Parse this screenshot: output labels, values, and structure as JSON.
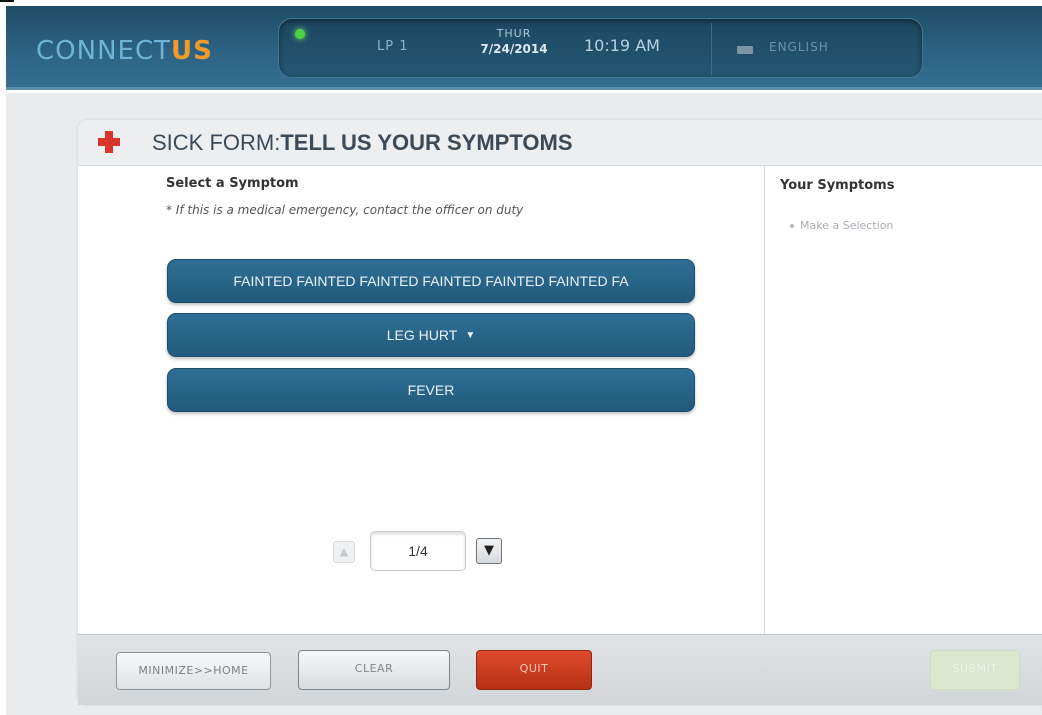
{
  "app": {
    "logo_main": "CONNECT",
    "logo_accent": "US"
  },
  "status": {
    "unit": "LP 1",
    "day": "THUR",
    "date": "7/24/2014",
    "time": "10:19 AM",
    "language": "ENGLISH"
  },
  "form": {
    "title_prefix": "SICK FORM:",
    "title_main": "TELL US YOUR SYMPTOMS",
    "select_heading": "Select a Symptom",
    "note": "* If this is a medical emergency, contact the officer on duty",
    "symptoms": [
      {
        "label": "FAINTED FAINTED FAINTED FAINTED FAINTED FAINTED FA"
      },
      {
        "label": "LEG HURT",
        "has_dropdown": true
      },
      {
        "label": "FEVER"
      }
    ],
    "pager": {
      "value": "1/4",
      "up_icon": "▲",
      "down_icon": "▼"
    }
  },
  "your_symptoms": {
    "heading": "Your Symptoms",
    "placeholder": "Make a Selection"
  },
  "footer": {
    "minimize_label": "MINIMIZE>>HOME",
    "clear_label": "CLEAR",
    "quit_label": "QUIT",
    "submit_label": "SUBMIT"
  },
  "colors": {
    "header": "#2c6282",
    "accent_orange": "#f09a2a",
    "symptom_button": "#215a7c",
    "quit": "#c73a1d",
    "cross_red": "#d9362b"
  }
}
